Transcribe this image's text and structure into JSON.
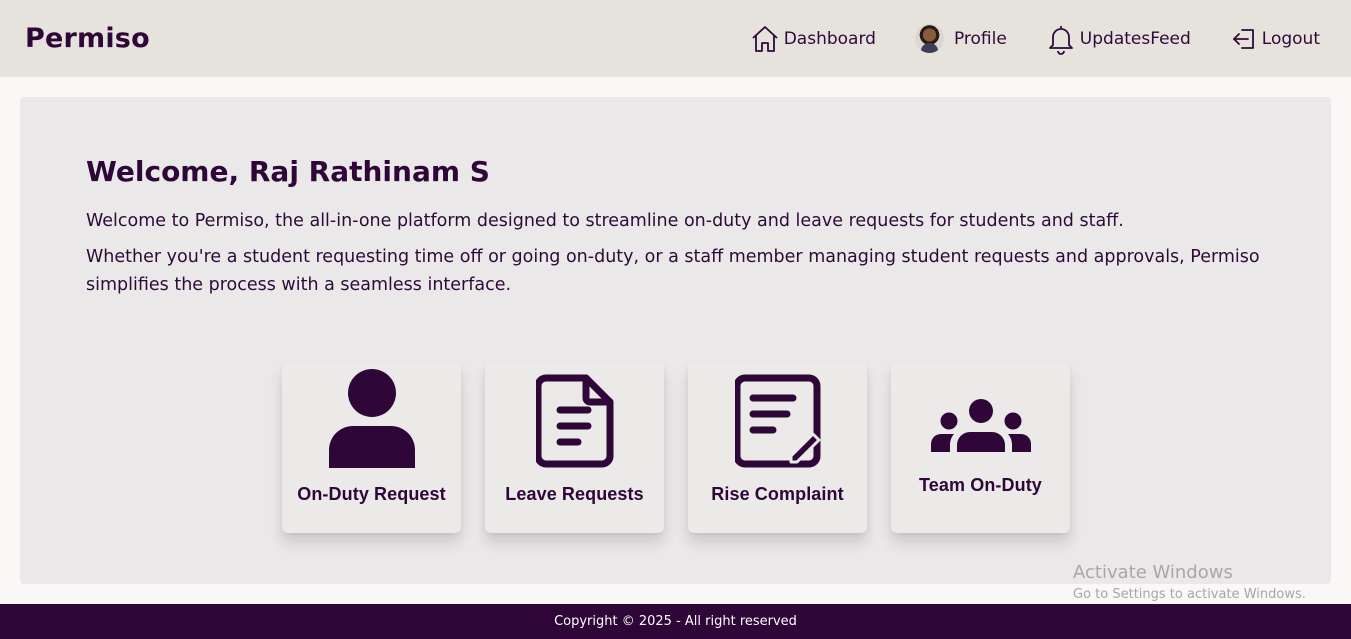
{
  "brand": "Permiso",
  "nav": {
    "items": [
      {
        "label": "Dashboard",
        "icon": "home-icon"
      },
      {
        "label": "Profile",
        "icon": "avatar"
      },
      {
        "label": "UpdatesFeed",
        "icon": "bell-icon"
      },
      {
        "label": "Logout",
        "icon": "logout-icon"
      }
    ]
  },
  "welcome": {
    "title": "Welcome, Raj Rathinam S",
    "paragraph1": "Welcome to Permiso, the all-in-one platform designed to streamline on-duty and leave requests for students and staff.",
    "paragraph2": "Whether you're a student requesting time off or going on-duty, or a staff member managing student requests and approvals, Permiso simplifies the process with a seamless interface."
  },
  "tiles": [
    {
      "label": "On-Duty Request",
      "icon": "user-icon"
    },
    {
      "label": "Leave Requests",
      "icon": "document-icon"
    },
    {
      "label": "Rise Complaint",
      "icon": "edit-document-icon"
    },
    {
      "label": "Team On-Duty",
      "icon": "team-icon"
    }
  ],
  "watermark": {
    "title": "Activate Windows",
    "subtitle": "Go to Settings to activate Windows."
  },
  "footer": {
    "text": "Copyright © 2025 - All right reserved"
  },
  "colors": {
    "brand": "#2e0638",
    "navbar_bg": "#e6e2dc",
    "card_bg": "#eae8e8",
    "footer_bg": "#2e0638"
  }
}
